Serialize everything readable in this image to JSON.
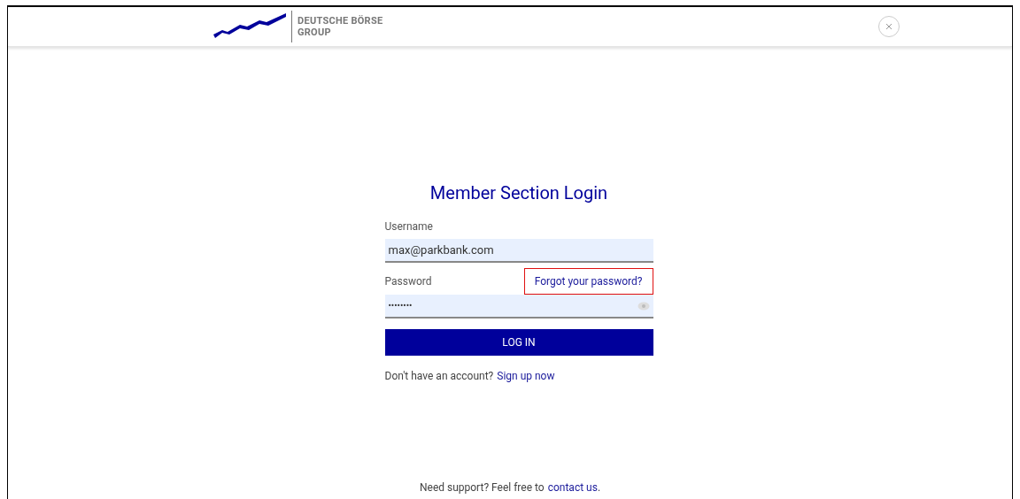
{
  "header": {
    "brand_line_1": "DEUTSCHE BÖRSE",
    "brand_line_2": "GROUP"
  },
  "login": {
    "title": "Member Section Login",
    "username": {
      "label": "Username",
      "value": "max@parkbank.com"
    },
    "password": {
      "label": "Password",
      "value": "••••••••",
      "forgot_link": "Forgot your password?",
      "forgot_highlighted": true
    },
    "button": "LOG IN",
    "signup": {
      "text": "Don't have an account?",
      "link": "Sign up now"
    }
  },
  "footer": {
    "text": "Need support? Feel free to",
    "link": "contact us",
    "suffix": "."
  }
}
